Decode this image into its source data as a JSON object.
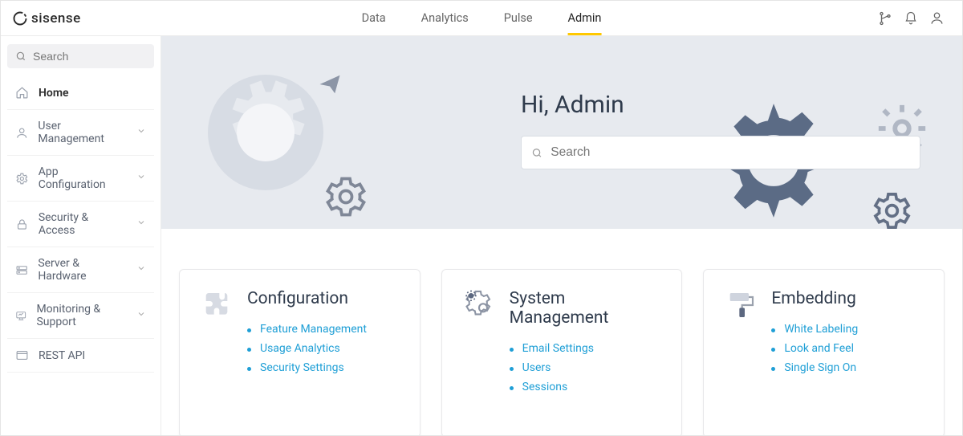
{
  "topnav": {
    "brand": "sisense",
    "tabs": [
      {
        "label": "Data"
      },
      {
        "label": "Analytics"
      },
      {
        "label": "Pulse"
      },
      {
        "label": "Admin",
        "active": true
      }
    ]
  },
  "sidebar": {
    "search_placeholder": "Search",
    "items": [
      {
        "label": "Home",
        "icon": "home",
        "active": true
      },
      {
        "label": "User Management",
        "icon": "user",
        "expandable": true
      },
      {
        "label": "App Configuration",
        "icon": "gear",
        "expandable": true
      },
      {
        "label": "Security & Access",
        "icon": "lock",
        "expandable": true
      },
      {
        "label": "Server & Hardware",
        "icon": "server",
        "expandable": true
      },
      {
        "label": "Monitoring & Support",
        "icon": "monitor",
        "expandable": true
      },
      {
        "label": "REST API",
        "icon": "api"
      }
    ]
  },
  "hero": {
    "greeting": "Hi, Admin",
    "search_placeholder": "Search"
  },
  "cards": [
    {
      "title": "Configuration",
      "icon": "puzzle",
      "links": [
        "Feature Management",
        "Usage Analytics",
        "Security Settings"
      ]
    },
    {
      "title": "System Management",
      "icon": "gears",
      "links": [
        "Email Settings",
        "Users",
        "Sessions"
      ]
    },
    {
      "title": "Embedding",
      "icon": "paint",
      "links": [
        "White Labeling",
        "Look and Feel",
        "Single Sign On"
      ]
    }
  ]
}
